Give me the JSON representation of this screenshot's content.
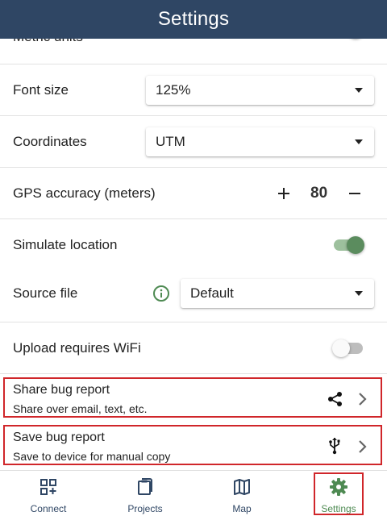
{
  "header": {
    "title": "Settings"
  },
  "settings": {
    "metric_units": {
      "label": "Metric units",
      "value": true
    },
    "font_size": {
      "label": "Font size",
      "selected": "125%"
    },
    "coordinates": {
      "label": "Coordinates",
      "selected": "UTM"
    },
    "gps_accuracy": {
      "label": "GPS accuracy (meters)",
      "value": "80",
      "plus": "+",
      "minus": "−"
    },
    "simulate_location": {
      "label": "Simulate location",
      "value": true
    },
    "source_file": {
      "label": "Source file",
      "selected": "Default"
    },
    "upload_wifi": {
      "label": "Upload requires WiFi",
      "value": false
    }
  },
  "actions": {
    "share": {
      "title": "Share bug report",
      "subtitle": "Share over email, text, etc.",
      "icon": "share-icon"
    },
    "save": {
      "title": "Save bug report",
      "subtitle": "Save to device for manual copy",
      "icon": "usb-icon"
    }
  },
  "tabs": [
    {
      "label": "Connect",
      "icon": "qr-code-icon",
      "active": false
    },
    {
      "label": "Projects",
      "icon": "clipboard-icon",
      "active": false
    },
    {
      "label": "Map",
      "icon": "map-icon",
      "active": false
    },
    {
      "label": "Settings",
      "icon": "gear-icon",
      "active": true
    }
  ],
  "colors": {
    "header": "#2f4664",
    "accent": "#4e8a52",
    "highlight": "#d0262a"
  }
}
